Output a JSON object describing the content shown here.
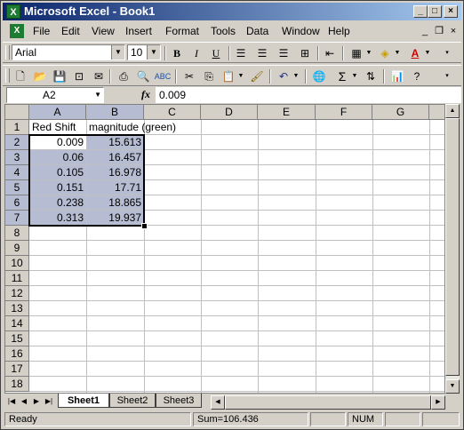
{
  "window": {
    "title": "Microsoft Excel - Book1",
    "app_icon_glyph": "X"
  },
  "menu": [
    "File",
    "Edit",
    "View",
    "Insert",
    "Format",
    "Tools",
    "Data",
    "Window",
    "Help"
  ],
  "formatting_toolbar": {
    "font": "Arial",
    "size": "10"
  },
  "formula_bar": {
    "cell_ref": "A2",
    "fx": "fx",
    "value": "0.009"
  },
  "grid": {
    "columns": [
      "A",
      "B",
      "C",
      "D",
      "E",
      "F",
      "G"
    ],
    "rows": [
      "1",
      "2",
      "3",
      "4",
      "5",
      "6",
      "7",
      "8",
      "9",
      "10",
      "11",
      "12",
      "13",
      "14",
      "15",
      "16",
      "17",
      "18"
    ],
    "selected_range": "A2:B7",
    "cells": {
      "A1": "Red Shift",
      "B1": "magnitude (green)",
      "A2": "0.009",
      "B2": "15.613",
      "A3": "0.06",
      "B3": "16.457",
      "A4": "0.105",
      "B4": "16.978",
      "A5": "0.151",
      "B5": "17.71",
      "A6": "0.238",
      "B6": "18.865",
      "A7": "0.313",
      "B7": "19.937"
    }
  },
  "sheet_tabs": [
    {
      "label": "Sheet1",
      "active": true
    },
    {
      "label": "Sheet2",
      "active": false
    },
    {
      "label": "Sheet3",
      "active": false
    }
  ],
  "status_bar": {
    "mode": "Ready",
    "sum": "Sum=106.436",
    "num": "NUM"
  },
  "colors": {
    "title_bar_start": "#0a246a",
    "title_bar_end": "#a6caf0",
    "selection": "#b6bdd2"
  }
}
